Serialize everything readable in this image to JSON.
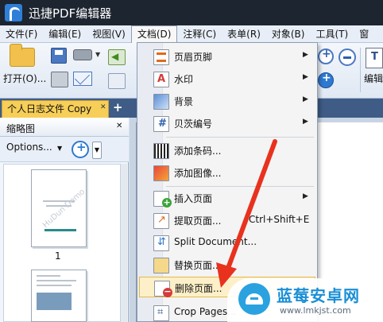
{
  "window": {
    "title": "迅捷PDF编辑器"
  },
  "menubar": {
    "items": [
      "文件(F)",
      "编辑(E)",
      "视图(V)",
      "文档(D)",
      "注释(C)",
      "表单(R)",
      "对象(B)",
      "工具(T)",
      "窗"
    ]
  },
  "ribbon": {
    "open_label": "打开(O)...",
    "edit_label": "编辑"
  },
  "tabs": {
    "doc_tab": "个人日志文件 Copy",
    "close_glyph": "✕",
    "add_glyph": "+"
  },
  "thumbnail_panel": {
    "title": "缩略图",
    "close_glyph": "✕",
    "options_label": "Options...",
    "page1_label": "1",
    "watermark_text": "HuDun Demo"
  },
  "document_menu": {
    "items": [
      {
        "label": "页眉页脚",
        "icon": "header-footer-icon",
        "submenu": true
      },
      {
        "label": "水印",
        "icon": "watermark-icon",
        "submenu": true
      },
      {
        "label": "背景",
        "icon": "background-icon",
        "submenu": true
      },
      {
        "label": "贝茨编号",
        "icon": "bates-number-icon",
        "submenu": true
      },
      {
        "label": "添加条码...",
        "icon": "barcode-icon",
        "submenu": false
      },
      {
        "label": "添加图像...",
        "icon": "add-image-icon",
        "submenu": false
      },
      {
        "label": "插入页面",
        "icon": "insert-page-icon",
        "submenu": true
      },
      {
        "label": "提取页面...",
        "icon": "extract-page-icon",
        "submenu": false,
        "shortcut": "Ctrl+Shift+E"
      },
      {
        "label": "Split Document...",
        "icon": "split-document-icon",
        "submenu": false
      },
      {
        "label": "替换页面...",
        "icon": "replace-page-icon",
        "submenu": false
      },
      {
        "label": "删除页面...",
        "icon": "delete-page-icon",
        "submenu": false,
        "highlighted": true
      },
      {
        "label": "Crop Pages...",
        "icon": "crop-pages-icon",
        "submenu": false
      }
    ]
  },
  "site_watermark": {
    "name": "蓝莓安卓网",
    "url": "www.lmkjst.com"
  },
  "colors": {
    "titlebar": "#1d2530",
    "tab_active": "#f6ce58",
    "highlight": "#fdf0c8",
    "arrow": "#e8321e",
    "brand": "#1a8fd6"
  }
}
